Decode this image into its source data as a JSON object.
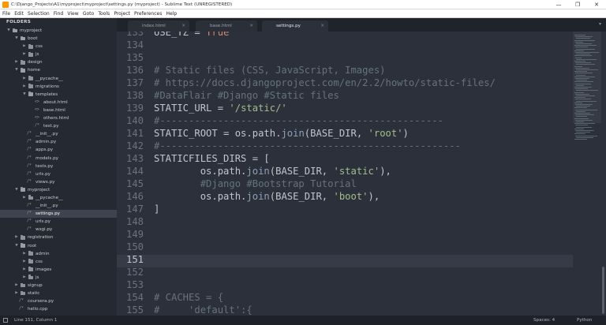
{
  "window": {
    "title": "C:\\Django_Projects\\A1\\myproject\\myproject\\settings.py (myproject) - Sublime Text (UNREGISTERED)",
    "controls": [
      "—",
      "❐",
      "✕"
    ]
  },
  "menu": [
    "File",
    "Edit",
    "Selection",
    "Find",
    "View",
    "Goto",
    "Tools",
    "Project",
    "Preferences",
    "Help"
  ],
  "sidebar": {
    "title": "FOLDERS",
    "items": [
      {
        "label": "myproject",
        "type": "folder",
        "open": true
      },
      {
        "label": "boot",
        "type": "folder",
        "open": true
      },
      {
        "label": "css",
        "type": "folder",
        "open": false
      },
      {
        "label": "js",
        "type": "folder",
        "open": false
      },
      {
        "label": "design",
        "type": "folder",
        "open": false
      },
      {
        "label": "home",
        "type": "folder",
        "open": true
      },
      {
        "label": "__pycache__",
        "type": "folder",
        "open": false
      },
      {
        "label": "migrations",
        "type": "folder",
        "open": false
      },
      {
        "label": "templates",
        "type": "folder",
        "open": true
      },
      {
        "label": "about.html",
        "type": "html"
      },
      {
        "label": "base.html",
        "type": "html"
      },
      {
        "label": "others.html",
        "type": "html"
      },
      {
        "label": "test.py",
        "type": "py"
      },
      {
        "label": "__init__.py",
        "type": "py"
      },
      {
        "label": "admin.py",
        "type": "py"
      },
      {
        "label": "apps.py",
        "type": "py"
      },
      {
        "label": "models.py",
        "type": "py"
      },
      {
        "label": "tests.py",
        "type": "py"
      },
      {
        "label": "urls.py",
        "type": "py"
      },
      {
        "label": "views.py",
        "type": "py"
      },
      {
        "label": "myproject",
        "type": "folder",
        "open": true
      },
      {
        "label": "__pycache__",
        "type": "folder",
        "open": false
      },
      {
        "label": "__init__.py",
        "type": "py"
      },
      {
        "label": "settings.py",
        "type": "py"
      },
      {
        "label": "urls.py",
        "type": "py"
      },
      {
        "label": "wsgi.py",
        "type": "py"
      },
      {
        "label": "registration",
        "type": "folder",
        "open": false
      },
      {
        "label": "root",
        "type": "folder",
        "open": true
      },
      {
        "label": "admin",
        "type": "folder",
        "open": false
      },
      {
        "label": "css",
        "type": "folder",
        "open": false
      },
      {
        "label": "images",
        "type": "folder",
        "open": false
      },
      {
        "label": "js",
        "type": "folder",
        "open": false
      },
      {
        "label": "signup",
        "type": "folder",
        "open": false
      },
      {
        "label": "static",
        "type": "folder",
        "open": false
      },
      {
        "label": "coursera.py",
        "type": "py"
      },
      {
        "label": "hello.cpp",
        "type": "cpp"
      }
    ]
  },
  "tabs": [
    {
      "label": "index.html",
      "active": false
    },
    {
      "label": "base.html",
      "active": false
    },
    {
      "label": "settings.py",
      "active": true
    }
  ],
  "tab_close": "✕",
  "tab_menu": "▾",
  "editor": {
    "line_numbers": [
      "133",
      "134",
      "135",
      "136",
      "137",
      "138",
      "139",
      "140",
      "141",
      "142",
      "143",
      "144",
      "145",
      "146",
      "147",
      "148",
      "149",
      "150",
      "151",
      "152",
      "153",
      "154",
      "155"
    ],
    "current_line": "151",
    "lines": [
      [
        {
          "t": "USE_TZ = ",
          "c": ""
        },
        {
          "t": "True",
          "c": "kw"
        }
      ],
      [],
      [],
      [
        {
          "t": "# Static files (CSS, JavaScript, Images)",
          "c": "comment"
        }
      ],
      [
        {
          "t": "# https://docs.djangoproject.com/en/2.2/howto/static-files/",
          "c": "comment"
        }
      ],
      [
        {
          "t": "#DataFlair #Django #Static files",
          "c": "comment"
        }
      ],
      [
        {
          "t": "STATIC_URL = ",
          "c": ""
        },
        {
          "t": "'/static/'",
          "c": "str"
        }
      ],
      [
        {
          "t": "#-------------------------------------------------",
          "c": "comment"
        }
      ],
      [
        {
          "t": "STATIC_ROOT = os.path.",
          "c": ""
        },
        {
          "t": "join",
          "c": "fn"
        },
        {
          "t": "(BASE_DIR, ",
          "c": ""
        },
        {
          "t": "'root'",
          "c": "str"
        },
        {
          "t": ")",
          "c": ""
        }
      ],
      [
        {
          "t": "#----------------------------------------------------",
          "c": "comment"
        }
      ],
      [
        {
          "t": "STATICFILES_DIRS = [",
          "c": ""
        }
      ],
      [
        {
          "t": "        os.path.",
          "c": ""
        },
        {
          "t": "join",
          "c": "fn"
        },
        {
          "t": "(BASE_DIR, ",
          "c": ""
        },
        {
          "t": "'static'",
          "c": "str"
        },
        {
          "t": "),",
          "c": ""
        }
      ],
      [
        {
          "t": "        #Django #Bootstrap Tutorial",
          "c": "comment"
        }
      ],
      [
        {
          "t": "        os.path.",
          "c": ""
        },
        {
          "t": "join",
          "c": "fn"
        },
        {
          "t": "(BASE_DIR, ",
          "c": ""
        },
        {
          "t": "'boot'",
          "c": "str"
        },
        {
          "t": "),",
          "c": ""
        }
      ],
      [
        {
          "t": "]",
          "c": ""
        }
      ],
      [],
      [],
      [],
      [],
      [],
      [],
      [
        {
          "t": "# CACHES = {",
          "c": "comment"
        }
      ],
      [
        {
          "t": "#     'default':{",
          "c": "comment"
        }
      ]
    ]
  },
  "status": {
    "position": "Line 151, Column 1",
    "spaces": "Spaces: 4",
    "syntax": "Python"
  }
}
